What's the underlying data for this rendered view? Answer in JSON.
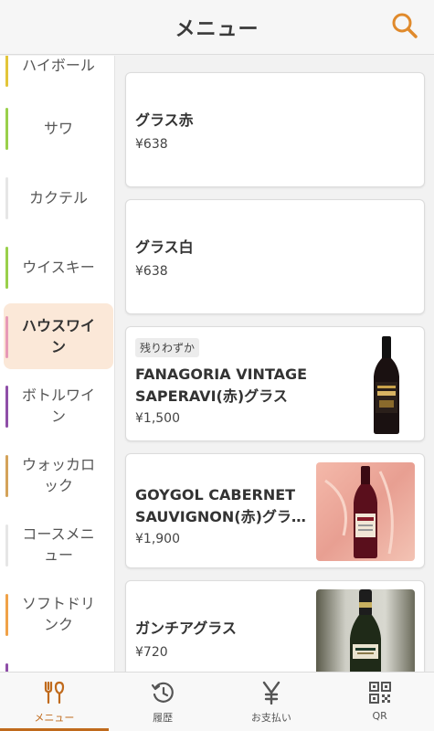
{
  "header": {
    "title": "メニュー"
  },
  "sidebar": {
    "items": [
      {
        "label": "ハイボール",
        "color": "#e3c53a"
      },
      {
        "label": "サワ",
        "color": "#9ad04b"
      },
      {
        "label": "カクテル",
        "color": "#e6e6e6"
      },
      {
        "label": "ウイスキー",
        "color": "#9ad04b"
      },
      {
        "label": "ハウスワイン",
        "color": "#e79ab7",
        "active": true
      },
      {
        "label": "ボトルワイン",
        "color": "#8f4fa8"
      },
      {
        "label": "ウォッカロック",
        "color": "#d4a35a"
      },
      {
        "label": "コースメニュー",
        "color": "#e6e6e6"
      },
      {
        "label": "ソフトドリンク",
        "color": "#f0a248"
      }
    ]
  },
  "products": [
    {
      "name": "グラス赤",
      "price": "¥638"
    },
    {
      "name": "グラス白",
      "price": "¥638"
    },
    {
      "badge": "残りわずか",
      "name_line1": "FANAGORIA VINTAGE",
      "name_line2": "SAPERAVI(赤)グラス",
      "price": "¥1,500"
    },
    {
      "name_line1": "GOYGOL CABERNET",
      "name_line2": "SAUVIGNON(赤)グラ…",
      "price": "¥1,900"
    },
    {
      "name": "ガンチアグラス",
      "price": "¥720"
    }
  ],
  "tabbar": {
    "tabs": [
      {
        "label": "メニュー",
        "icon": "fork-knife-icon",
        "active": true
      },
      {
        "label": "履歴",
        "icon": "history-icon"
      },
      {
        "label": "お支払い",
        "icon": "yen-icon"
      },
      {
        "label": "QR",
        "icon": "qr-code-icon"
      }
    ]
  },
  "colors": {
    "accent": "#c06a1c",
    "active_category_bg": "#fbe8d8"
  }
}
